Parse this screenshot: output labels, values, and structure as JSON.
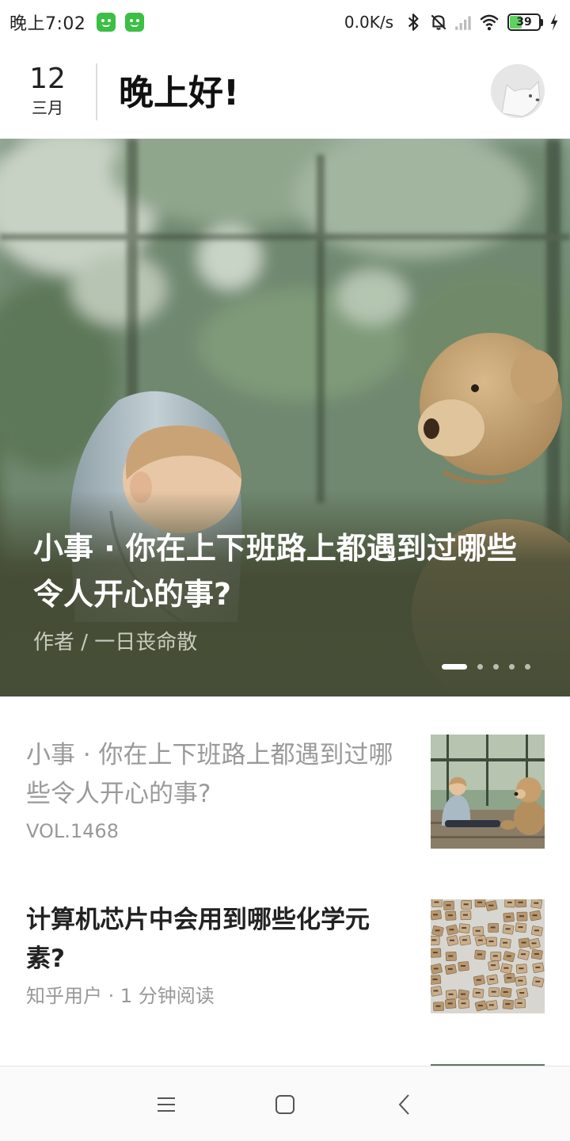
{
  "status_bar": {
    "time": "晚上7:02",
    "net_speed": "0.0K/s",
    "battery_percent": "39",
    "battery_level": 0.39,
    "icons": [
      "app-notification-icon",
      "app-notification-icon",
      "bluetooth-icon",
      "mute-icon",
      "signal-icon",
      "wifi-icon",
      "battery-icon",
      "charging-icon"
    ]
  },
  "header": {
    "day": "12",
    "month": "三月",
    "greeting": "晚上好!",
    "avatar_icon": "dog-avatar-icon"
  },
  "hero": {
    "title": "小事 · 你在上下班路上都遇到过哪些令人开心的事?",
    "author": "作者 / 一日丧命散",
    "slides_total": 5,
    "slide_active": 1
  },
  "list": [
    {
      "title": "小事 · 你在上下班路上都遇到过哪些令人开心的事?",
      "meta": "VOL.1468",
      "read": true,
      "thumb": "child-and-teddy-bear-image"
    },
    {
      "title": "计算机芯片中会用到哪些化学元素?",
      "meta": "知乎用户 · 1 分钟阅读",
      "read": false,
      "thumb": "element-tiles-image"
    }
  ],
  "nav_bar": {
    "icons": [
      "menu-icon",
      "home-square-icon",
      "back-chevron-icon"
    ]
  },
  "colors": {
    "hero_bottom": "#474e37",
    "title_text": "#222222",
    "read_title_text": "#9a9a9a",
    "meta_text": "#999999",
    "battery_fill": "#5fd160",
    "app_icon": "#3bbf45"
  }
}
